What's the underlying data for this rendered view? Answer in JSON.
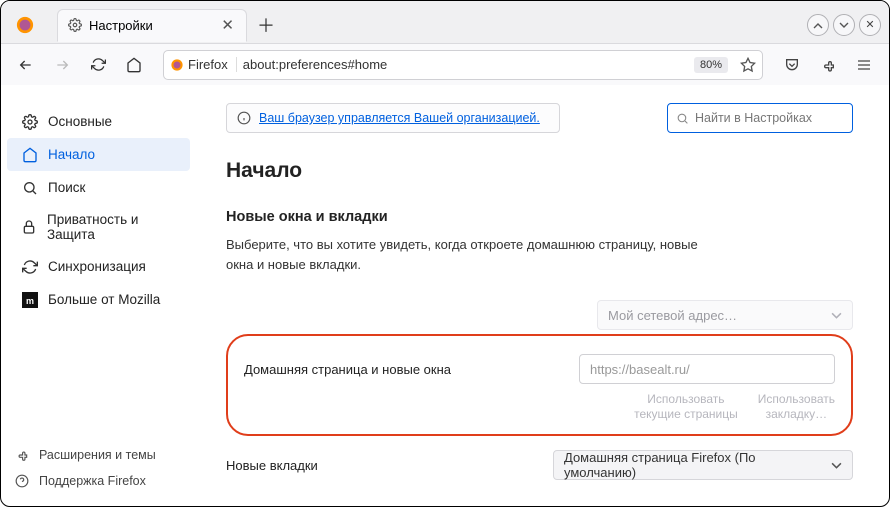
{
  "tab": {
    "label": "Настройки"
  },
  "url": {
    "identity": "Firefox",
    "path": "about:preferences#home",
    "zoom": "80%"
  },
  "sidebar": {
    "general": "Основные",
    "home": "Начало",
    "search": "Поиск",
    "privacy": "Приватность и Защита",
    "sync": "Синхронизация",
    "more": "Больше от Mozilla"
  },
  "footer": {
    "ext": "Расширения и темы",
    "support": "Поддержка Firefox"
  },
  "notice": "Ваш браузер управляется Вашей организацией.",
  "searchPlaceholder": "Найти в Настройках",
  "heading": "Начало",
  "section": {
    "title": "Новые окна и вкладки",
    "desc": "Выберите, что вы хотите увидеть, когда откроете домашнюю страницу, новые окна и новые вкладки."
  },
  "dimmed": "Мой сетевой адрес…",
  "homepage": {
    "label": "Домашняя страница и новые окна",
    "value": "https://basealt.ru/",
    "btn1": "Использовать\nтекущие страницы",
    "btn2": "Использовать\nзакладку…"
  },
  "newtabs": {
    "label": "Новые вкладки",
    "value": "Домашняя страница Firefox (По умолчанию)"
  }
}
